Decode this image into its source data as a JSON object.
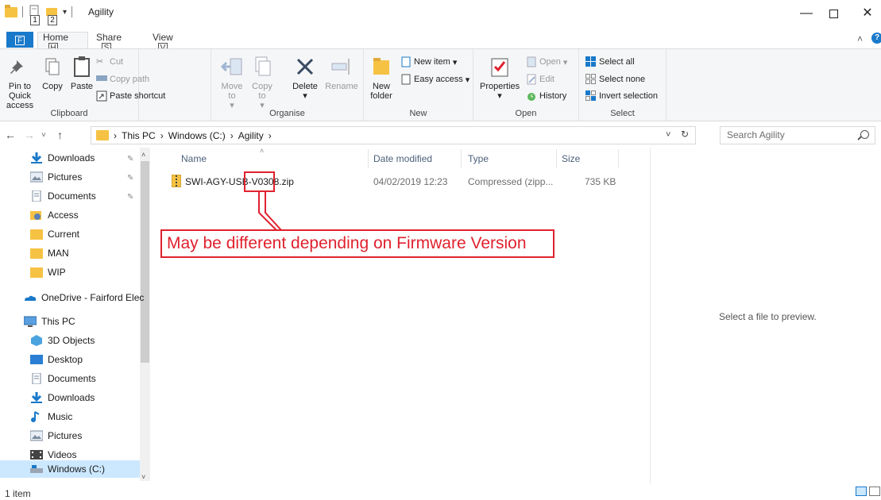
{
  "window": {
    "title": "Agility",
    "minimize": "—",
    "close": "✕"
  },
  "qat": {
    "key1": "1",
    "key2": "2"
  },
  "tabs": {
    "file": "F",
    "home": "Home",
    "home_key": "H",
    "share": "Share",
    "share_key": "S",
    "view": "View",
    "view_key": "V"
  },
  "ribbon": {
    "clipboard": {
      "label": "Clipboard",
      "pin": "Pin to Quick access",
      "copy": "Copy",
      "paste": "Paste",
      "cut": "Cut",
      "copy_path": "Copy path",
      "paste_shortcut": "Paste shortcut"
    },
    "organise": {
      "label": "Organise",
      "move_to": "Move to",
      "copy_to": "Copy to",
      "delete": "Delete",
      "rename": "Rename"
    },
    "new": {
      "label": "New",
      "new_folder": "New folder",
      "new_item": "New item",
      "easy_access": "Easy access"
    },
    "open": {
      "label": "Open",
      "properties": "Properties",
      "open": "Open",
      "edit": "Edit",
      "history": "History"
    },
    "select": {
      "label": "Select",
      "select_all": "Select all",
      "select_none": "Select none",
      "invert": "Invert selection"
    }
  },
  "address": {
    "crumbs": [
      "This PC",
      "Windows (C:)",
      "Agility"
    ],
    "search_placeholder": "Search Agility"
  },
  "nav": {
    "quick": [
      "Downloads",
      "Pictures",
      "Documents",
      "Access",
      "Current",
      "MAN",
      "WIP"
    ],
    "onedrive": "OneDrive - Fairford Elec",
    "thispc": "This PC",
    "pc_items": [
      "3D Objects",
      "Desktop",
      "Documents",
      "Downloads",
      "Music",
      "Pictures",
      "Videos",
      "Windows (C:)"
    ]
  },
  "columns": {
    "name": "Name",
    "date": "Date modified",
    "type": "Type",
    "size": "Size"
  },
  "files": [
    {
      "name": "SWI-AGY-USB-V0308.zip",
      "date": "04/02/2019 12:23",
      "type": "Compressed (zipp...",
      "size": "735 KB"
    }
  ],
  "annotation": "May be different depending on Firmware Version",
  "preview": "Select a file to preview.",
  "status": "1 item",
  "colors": {
    "accent": "#1979ca",
    "annotation": "#e0212e",
    "folder": "#f6c243"
  }
}
